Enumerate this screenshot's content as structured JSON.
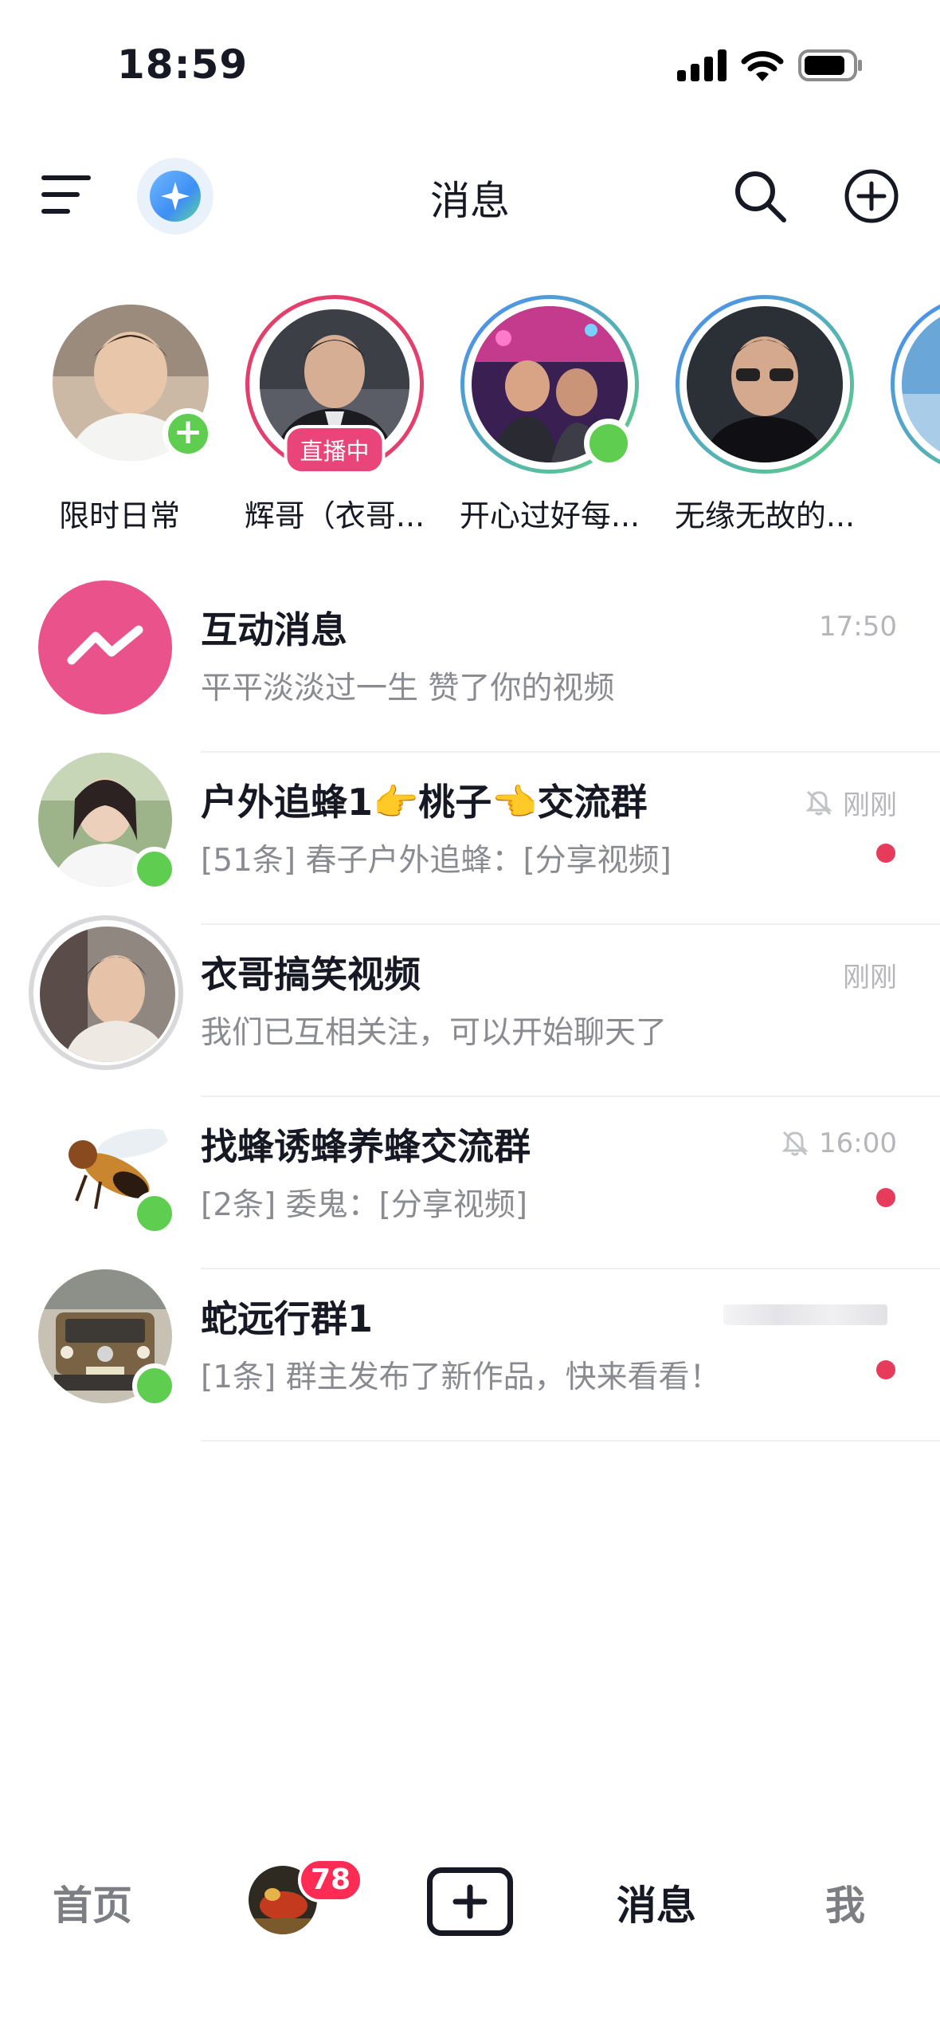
{
  "status_bar": {
    "time": "18:59"
  },
  "header": {
    "title": "消息"
  },
  "stories": [
    {
      "name": "限时日常"
    },
    {
      "name": "辉哥（衣哥...",
      "live_label": "直播中"
    },
    {
      "name": "开心过好每..."
    },
    {
      "name": "无缘无故的..."
    }
  ],
  "messages": [
    {
      "title": "互动消息",
      "subtitle": "平平淡淡过一生 赞了你的视频",
      "time": "17:50"
    },
    {
      "title": "户外追蜂1👉桃子👈交流群",
      "subtitle": "[51条] 春子户外追蜂：[分享视频]",
      "time": "刚刚",
      "muted": true,
      "unread": true
    },
    {
      "title": "衣哥搞笑视频",
      "subtitle": "我们已互相关注，可以开始聊天了",
      "time": "刚刚"
    },
    {
      "title": "找蜂诱蜂养蜂交流群",
      "subtitle": "[2条] 委鬼：[分享视频]",
      "time": "16:00",
      "muted": true,
      "unread": true
    },
    {
      "title": "蛇远行群1",
      "subtitle": "[1条] 群主发布了新作品，快来看看！",
      "time": "",
      "unread": true
    }
  ],
  "bottom_nav": {
    "home": "首页",
    "friends_badge": "78",
    "messages": "消息",
    "me": "我"
  },
  "colors": {
    "accent_red": "#fe2c55",
    "online_green": "#5fcd4f",
    "interactive_pink": "#e9528a"
  }
}
